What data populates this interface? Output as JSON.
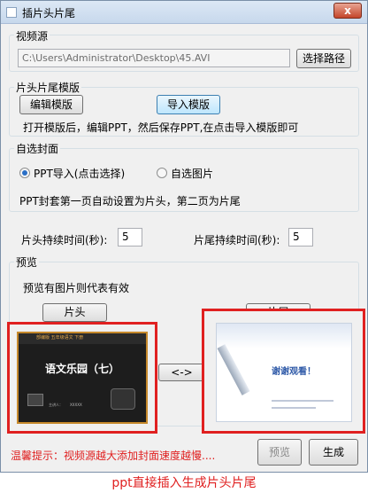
{
  "window": {
    "title": "插片头片尾",
    "close": "x"
  },
  "source": {
    "group_label": "视频源",
    "path_value": "C:\\Users\\Administrator\\Desktop\\45.AVI",
    "browse_button": "选择路径"
  },
  "template": {
    "group_label": "片头片尾模版",
    "edit_button": "编辑模版",
    "import_button": "导入模版",
    "hint": "打开模版后，编辑PPT，然后保存PPT,在点击导入模版即可"
  },
  "cover": {
    "group_label": "自选封面",
    "option_ppt": "PPT导入(点击选择)",
    "option_image": "自选图片",
    "selected": "ppt",
    "hint": "PPT封套第一页自动设置为片头，第二页为片尾"
  },
  "duration": {
    "head_label": "片头持续时间(秒):",
    "head_value": "5",
    "tail_label": "片尾持续时间(秒):",
    "tail_value": "5"
  },
  "preview": {
    "group_label": "预览",
    "hint": "预览有图片则代表有效",
    "head_button": "片头",
    "tail_button": "片尾",
    "swap_button": "<->",
    "head_slide": {
      "header": "部编版  五年级语文 下册",
      "title": "语文乐园（七）",
      "footer_left": "主讲人：",
      "footer_right": "XXXXX"
    },
    "tail_slide": {
      "title": "谢谢观看！"
    }
  },
  "bottom": {
    "warning": "温馨提示：视频源越大添加封面速度越慢....",
    "preview_button": "预览",
    "generate_button": "生成"
  },
  "caption": "ppt直接插入生成片头片尾",
  "colors": {
    "warning": "#e02020",
    "frame": "#e02020",
    "caption": "#e02020"
  }
}
